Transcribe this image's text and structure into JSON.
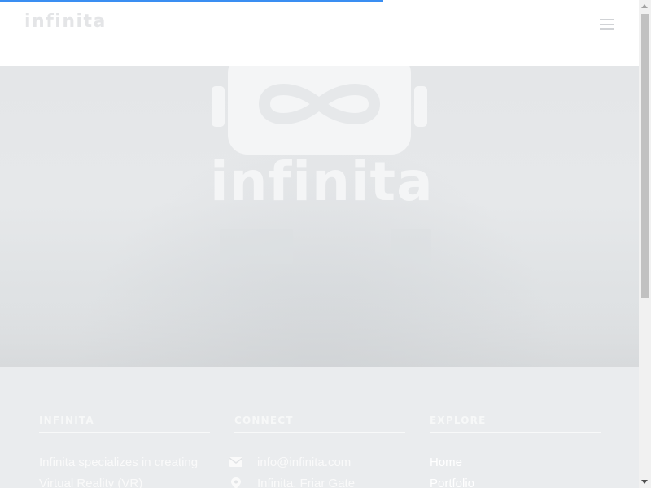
{
  "header": {
    "brand": "infinita",
    "menu_icon": "hamburger-menu-icon",
    "accent_color": "#3a8ef2",
    "page_load_progress": 0.6
  },
  "hero": {
    "logo_icon": "vr-headset-infinity-logo",
    "wordmark": "infinita"
  },
  "footer": {
    "about": {
      "title": "INFINITA",
      "text_lines": [
        "Infinita specializes in creating",
        "Virtual Reality (VR)"
      ]
    },
    "connect": {
      "title": "CONNECT",
      "items": [
        {
          "icon": "envelope-icon",
          "text": "info@infinita.com"
        },
        {
          "icon": "map-marker-icon",
          "text": "Infinita, Friar Gate"
        }
      ]
    },
    "explore": {
      "title": "EXPLORE",
      "links": [
        "Home",
        "Portfolio"
      ]
    }
  },
  "scrollbar": {
    "position_fraction": 0.0
  }
}
